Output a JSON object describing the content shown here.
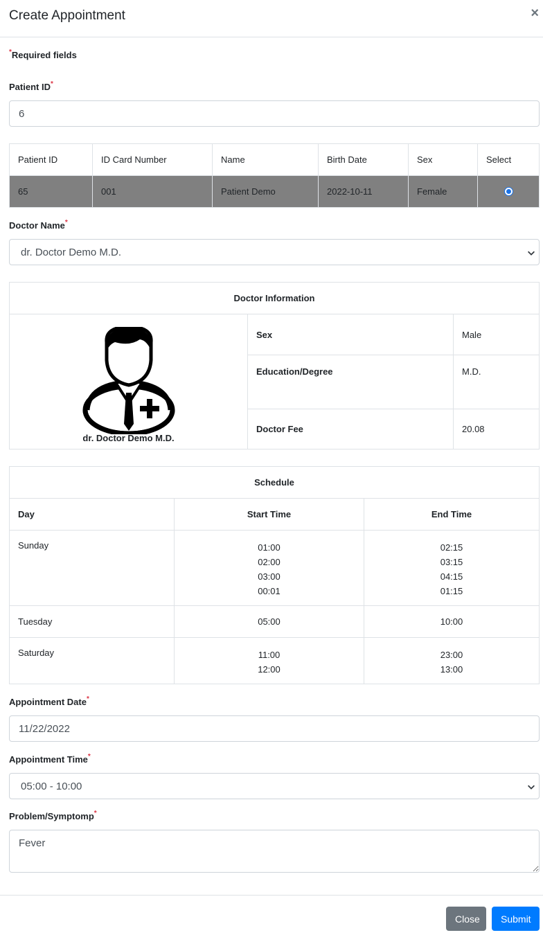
{
  "modal": {
    "title": "Create Appointment",
    "close_symbol": "×"
  },
  "required_note": "Required fields",
  "patient_id": {
    "label": "Patient ID",
    "value": "6"
  },
  "patient_table": {
    "headers": [
      "Patient ID",
      "ID Card Number",
      "Name",
      "Birth Date",
      "Sex",
      "Select"
    ],
    "rows": [
      {
        "patient_id": "65",
        "id_card": "001",
        "name": "Patient Demo",
        "birth_date": "2022-10-11",
        "sex": "Female",
        "selected": true
      }
    ]
  },
  "doctor_name": {
    "label": "Doctor Name",
    "value": "dr. Doctor Demo M.D."
  },
  "doctor_info": {
    "title": "Doctor Information",
    "caption": "dr. Doctor Demo M.D.",
    "avatar_icon": "doctor-avatar-icon",
    "rows": [
      {
        "key": "Sex",
        "value": "Male"
      },
      {
        "key": "Education/Degree",
        "value": "M.D."
      },
      {
        "key": "Doctor Fee",
        "value": "20.08"
      }
    ]
  },
  "schedule": {
    "title": "Schedule",
    "headers": [
      "Day",
      "Start Time",
      "End Time"
    ],
    "rows": [
      {
        "day": "Sunday",
        "start": [
          "01:00",
          "02:00",
          "03:00",
          "00:01"
        ],
        "end": [
          "02:15",
          "03:15",
          "04:15",
          "01:15"
        ]
      },
      {
        "day": "Tuesday",
        "start": [
          "05:00"
        ],
        "end": [
          "10:00"
        ]
      },
      {
        "day": "Saturday",
        "start": [
          "11:00",
          "12:00"
        ],
        "end": [
          "23:00",
          "13:00"
        ]
      }
    ]
  },
  "appointment_date": {
    "label": "Appointment Date",
    "value": "11/22/2022"
  },
  "appointment_time": {
    "label": "Appointment Time",
    "value": "05:00 - 10:00"
  },
  "problem": {
    "label": "Problem/Symptomp",
    "value": "Fever"
  },
  "footer": {
    "close_label": "Close",
    "submit_label": "Submit"
  },
  "colors": {
    "primary": "#007bff",
    "secondary": "#6c757d",
    "required": "#dc3545",
    "selected_row": "#808080"
  }
}
